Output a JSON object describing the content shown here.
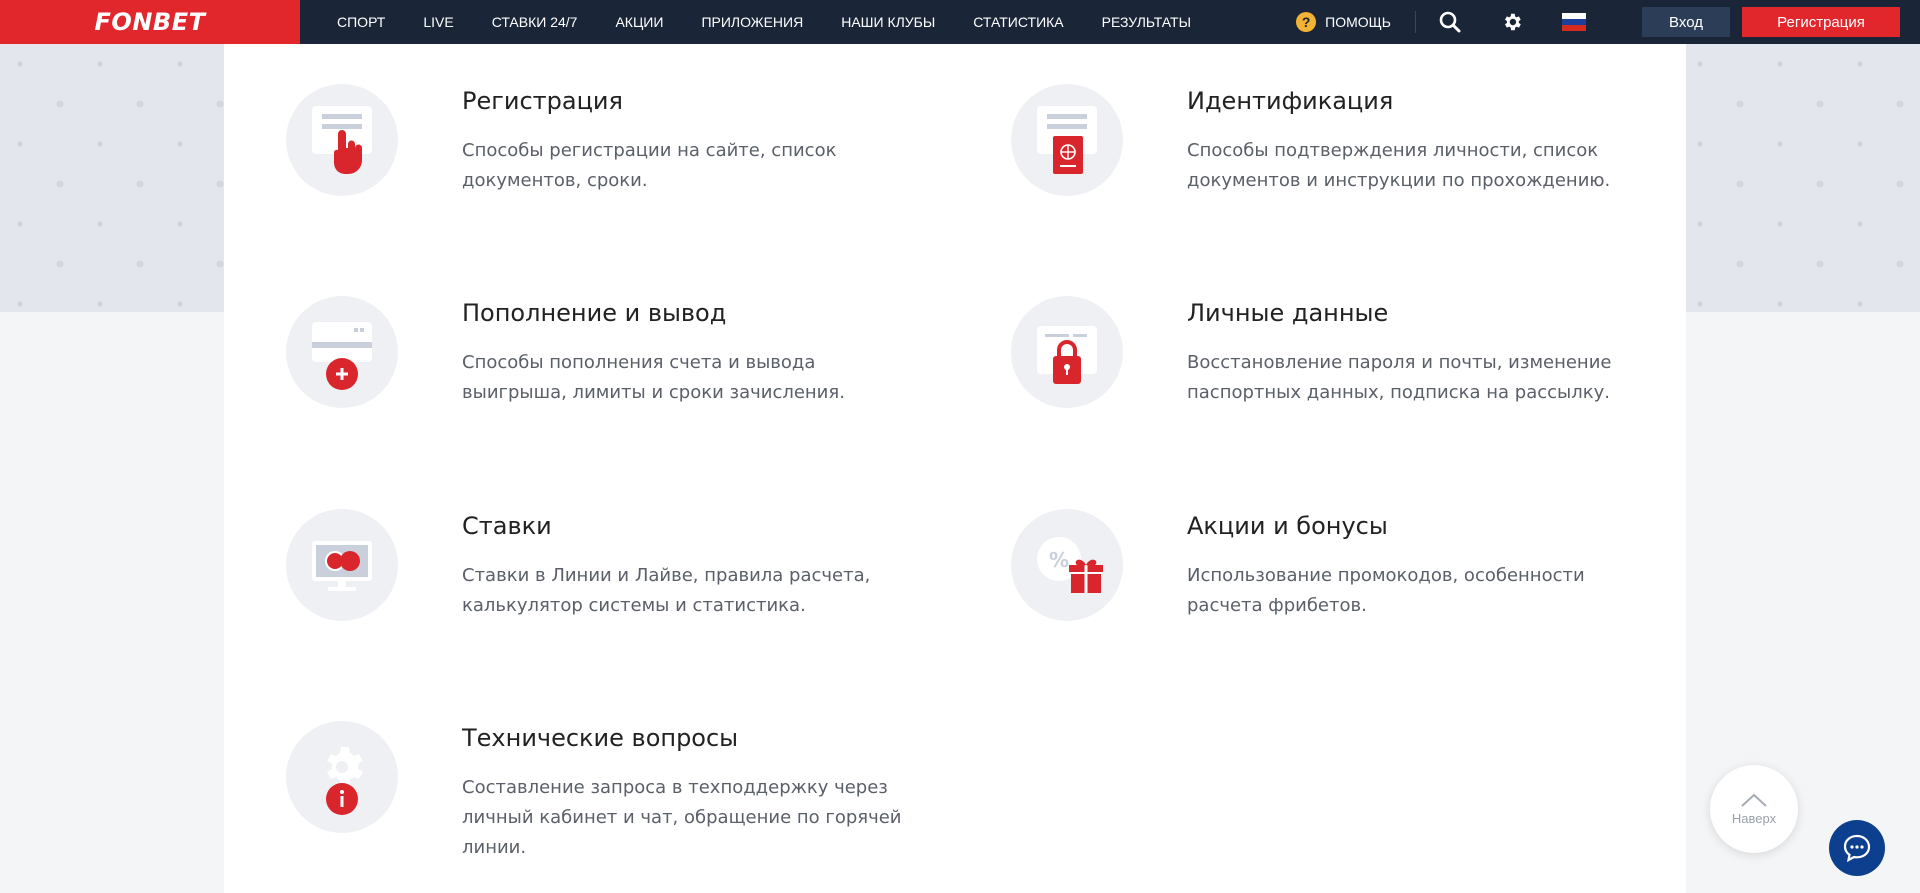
{
  "header": {
    "logo": "FONBET",
    "nav": [
      "СПОРТ",
      "LIVE",
      "СТАВКИ 24/7",
      "АКЦИИ",
      "ПРИЛОЖЕНИЯ",
      "НАШИ КЛУБЫ",
      "СТАТИСТИКА",
      "РЕЗУЛЬТАТЫ"
    ],
    "help_icon_glyph": "?",
    "help_label": "ПОМОЩЬ",
    "login_label": "Вход",
    "register_label": "Регистрация",
    "icons": [
      "search-icon",
      "gear-icon",
      "russia-flag-icon"
    ]
  },
  "topics": [
    {
      "title": "Регистрация",
      "desc": "Способы регистрации на сайте, список документов, сроки.",
      "icon": "registration-icon"
    },
    {
      "title": "Идентификация",
      "desc": "Способы подтверждения личности, список документов и инструкции по прохождению.",
      "icon": "passport-icon"
    },
    {
      "title": "Пополнение и вывод",
      "desc": "Способы пополнения счета и вывода выигрыша, лимиты и сроки зачисления.",
      "icon": "card-plus-icon"
    },
    {
      "title": "Личные данные",
      "desc": "Восстановление пароля и почты, изменение паспортных данных, подписка на рассылку.",
      "icon": "lock-icon"
    },
    {
      "title": "Ставки",
      "desc": "Ставки в Линии и Лайве, правила расчета, калькулятор системы и статистика.",
      "icon": "monitor-bets-icon"
    },
    {
      "title": "Акции и бонусы",
      "desc": "Использование промокодов, особенности расчета фрибетов.",
      "icon": "gift-percent-icon"
    },
    {
      "title": "Технические вопросы",
      "desc": "Составление запроса в техподдержку через личный кабинет и чат, обращение по горячей линии.",
      "icon": "gear-info-icon"
    }
  ],
  "to_top_label": "Наверх",
  "colors": {
    "brand_red": "#e1262c",
    "header_bg": "#1a2538",
    "login_bg": "#2c3d57",
    "chat_blue": "#0d3f8f"
  }
}
